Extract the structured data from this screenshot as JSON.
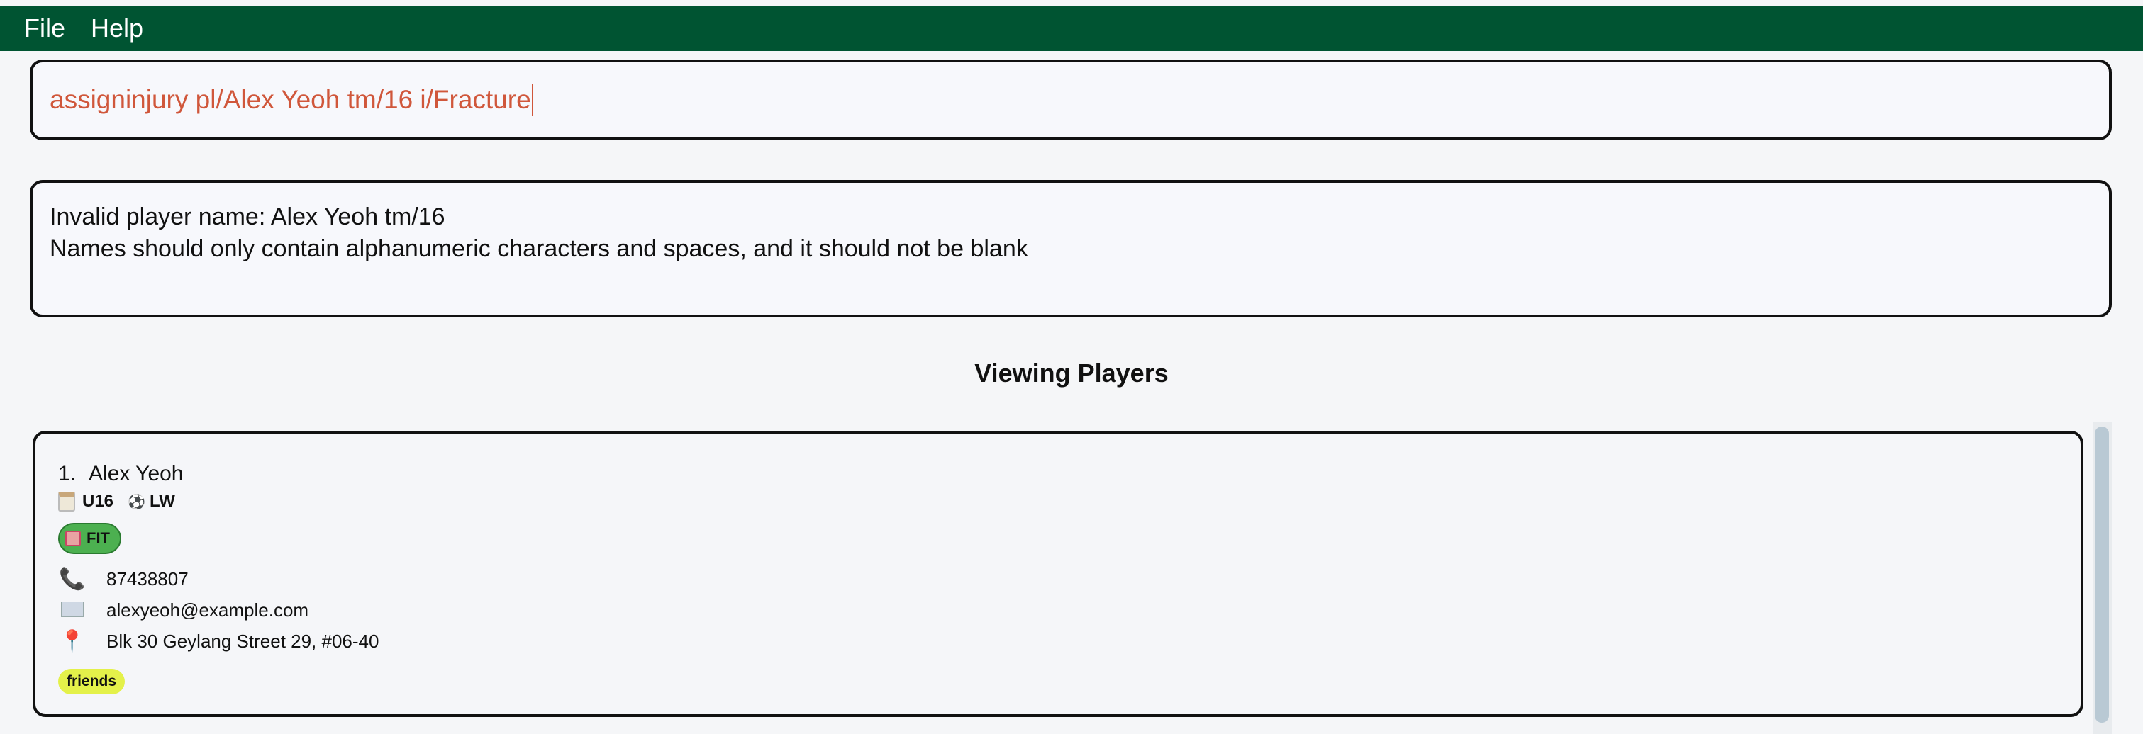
{
  "menu": {
    "file_label": "File",
    "help_label": "Help"
  },
  "command_box": {
    "value": "assigninjury pl/Alex Yeoh tm/16 i/Fracture"
  },
  "result_box": {
    "line1": "Invalid player name: Alex Yeoh tm/16",
    "line2": "Names should only contain alphanumeric characters and spaces, and it should not be blank"
  },
  "list": {
    "heading": "Viewing Players",
    "players": [
      {
        "index": "1.",
        "name": "Alex Yeoh",
        "team": "U16",
        "position": "LW",
        "status": "FIT",
        "phone": "87438807",
        "email": "alexyeoh@example.com",
        "address": "Blk 30 Geylang Street 29, #06-40",
        "tags": [
          "friends"
        ]
      }
    ]
  },
  "colors": {
    "menubar": "#005432",
    "command_text": "#d0573b",
    "status_fit": "#4cb050",
    "tag": "#e4f14a"
  },
  "icons": {
    "team": "calendar-icon",
    "position": "soccer-ball-icon",
    "status": "injury-status-icon",
    "phone": "phone-icon",
    "email": "mail-icon",
    "address": "map-pin-icon"
  }
}
